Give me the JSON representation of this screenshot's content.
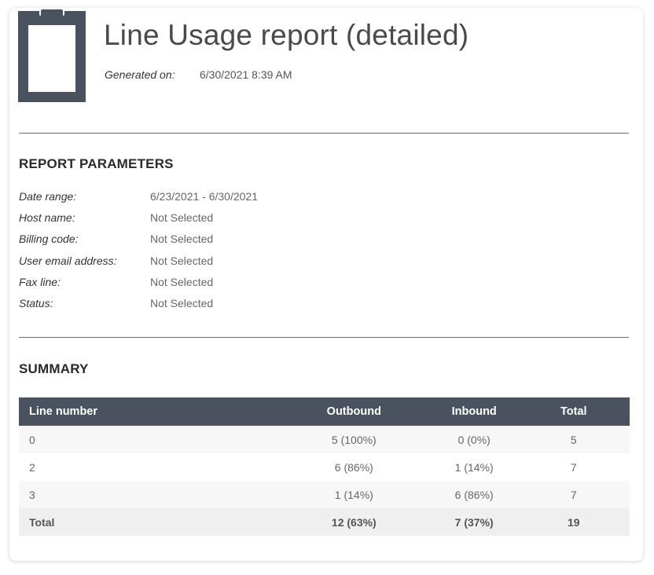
{
  "report": {
    "title": "Line Usage report (detailed)",
    "generated_label": "Generated on:",
    "generated_value": "6/30/2021 8:39 AM",
    "logo_icon": "clipboard-icon"
  },
  "colors": {
    "logo": "#4a5260",
    "table_header": "#4a5260"
  },
  "parameters": {
    "heading": "REPORT PARAMETERS",
    "rows": [
      {
        "label": "Date range:",
        "value": "6/23/2021 - 6/30/2021"
      },
      {
        "label": "Host name:",
        "value": "Not Selected"
      },
      {
        "label": "Billing code:",
        "value": "Not Selected"
      },
      {
        "label": "User email address:",
        "value": "Not Selected"
      },
      {
        "label": "Fax line:",
        "value": "Not Selected"
      },
      {
        "label": "Status:",
        "value": "Not Selected"
      }
    ]
  },
  "summary": {
    "heading": "SUMMARY",
    "columns": [
      "Line number",
      "Outbound",
      "Inbound",
      "Total"
    ],
    "rows": [
      {
        "line": "0",
        "outbound": "5 (100%)",
        "inbound": "0 (0%)",
        "total": "5"
      },
      {
        "line": "2",
        "outbound": "6 (86%)",
        "inbound": "1 (14%)",
        "total": "7"
      },
      {
        "line": "3",
        "outbound": "1 (14%)",
        "inbound": "6 (86%)",
        "total": "7"
      }
    ],
    "total_row": {
      "line": "Total",
      "outbound": "12 (63%)",
      "inbound": "7 (37%)",
      "total": "19"
    }
  }
}
